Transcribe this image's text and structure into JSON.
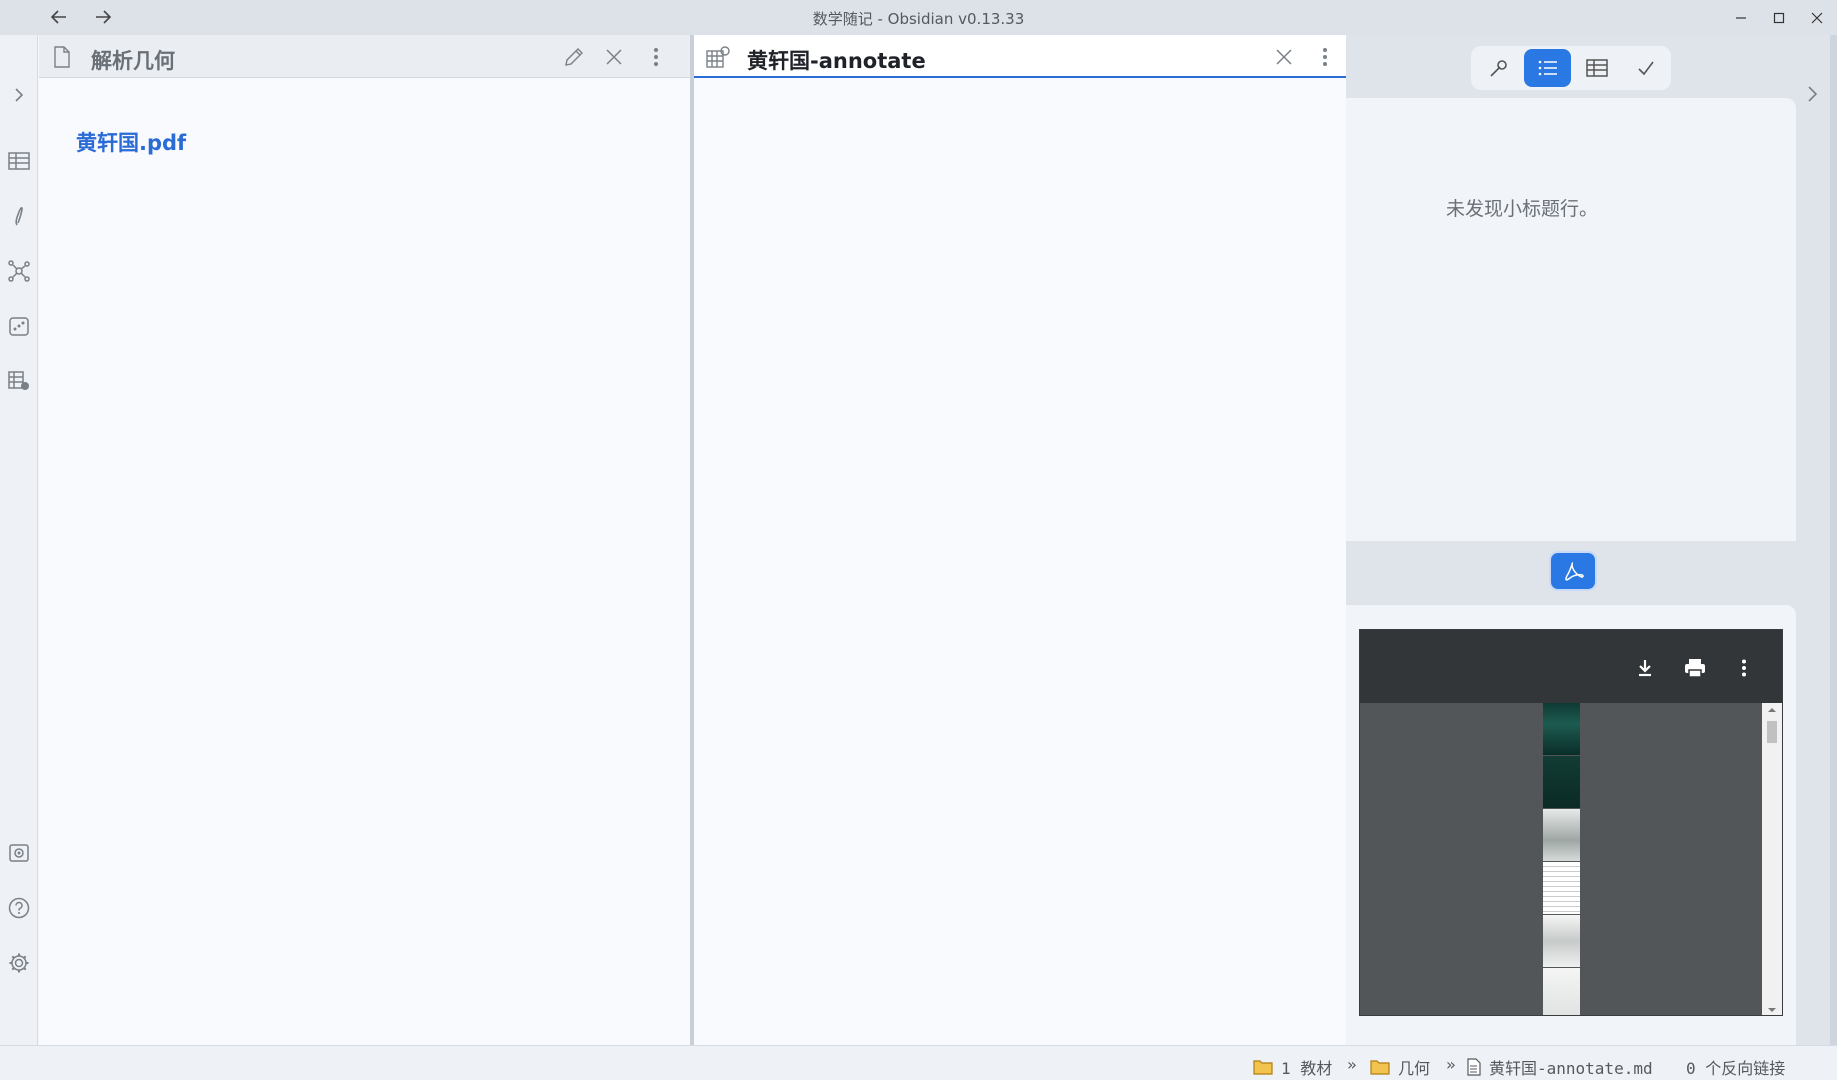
{
  "window": {
    "title": "数学随记 - Obsidian v0.13.33"
  },
  "nav": {
    "back_icon": "arrow-left-icon",
    "forward_icon": "arrow-right-icon"
  },
  "ribbon": {
    "items": [
      {
        "icon": "chevron-right-icon"
      },
      {
        "icon": "table-icon"
      },
      {
        "icon": "pen-icon"
      },
      {
        "icon": "graph-icon"
      },
      {
        "icon": "dice-icon"
      },
      {
        "icon": "table-settings-icon"
      },
      {
        "icon": "vault-icon"
      },
      {
        "icon": "help-icon"
      },
      {
        "icon": "gear-icon"
      }
    ]
  },
  "left_pane": {
    "title": "解析几何",
    "link_text": "黄轩国.pdf",
    "icons": [
      "file-icon",
      "pencil-icon",
      "close-icon",
      "more-icon"
    ]
  },
  "middle_pane": {
    "title": "黄轩国-annotate",
    "icons": [
      "annotate-grid-icon",
      "close-icon",
      "more-icon"
    ]
  },
  "right_sidebar": {
    "toolbar_buttons": [
      {
        "icon": "wand-icon",
        "active": false
      },
      {
        "icon": "list-icon",
        "active": true
      },
      {
        "icon": "table-icon",
        "active": false
      },
      {
        "icon": "check-icon",
        "active": false
      }
    ],
    "outline_empty_text": "未发现小标题行。",
    "pdf_button_icon": "acrobat-icon",
    "pdf_toolbar_icons": [
      "download-icon",
      "print-icon",
      "more-vertical-icon"
    ]
  },
  "status_bar": {
    "breadcrumb": [
      "1 教材",
      "几何",
      "黄轩国-annotate.md"
    ],
    "separator": "»",
    "backlinks": "0 个反向链接"
  },
  "colors": {
    "accent": "#2a78e4",
    "link": "#2a6bd6",
    "folder": "#e8a317"
  }
}
